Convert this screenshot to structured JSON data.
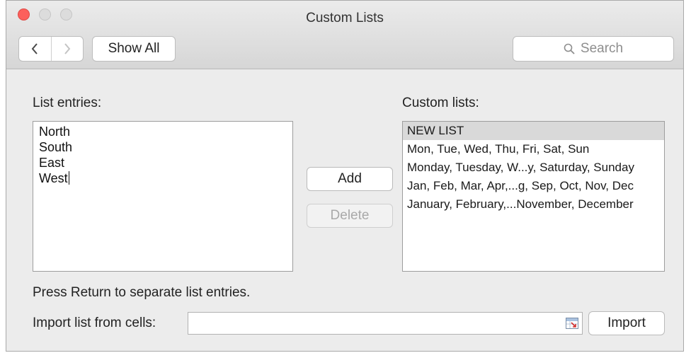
{
  "window": {
    "title": "Custom Lists"
  },
  "toolbar": {
    "back_icon": "chevron-left-icon",
    "forward_icon": "chevron-right-icon",
    "show_all_label": "Show All",
    "search_placeholder": "Search",
    "search_icon": "search-icon"
  },
  "entries": {
    "label": "List entries:",
    "items": [
      "North",
      "South",
      "East",
      "West"
    ]
  },
  "actions": {
    "add_label": "Add",
    "delete_label": "Delete"
  },
  "custom_lists": {
    "label": "Custom lists:",
    "items": [
      "NEW LIST",
      "Mon, Tue, Wed, Thu, Fri, Sat, Sun",
      "Monday, Tuesday, W...y, Saturday, Sunday",
      "Jan, Feb, Mar, Apr,...g, Sep, Oct, Nov, Dec",
      "January, February,...November, December"
    ],
    "selected_index": 0
  },
  "footer": {
    "hint": "Press Return to separate list entries.",
    "import_label": "Import list from cells:",
    "import_value": "",
    "collapse_icon": "range-select-icon",
    "import_button_label": "Import"
  },
  "colors": {
    "close": "#fc605c",
    "inactive_traffic": "#dcdcdc",
    "selection": "#d9d9d9"
  }
}
